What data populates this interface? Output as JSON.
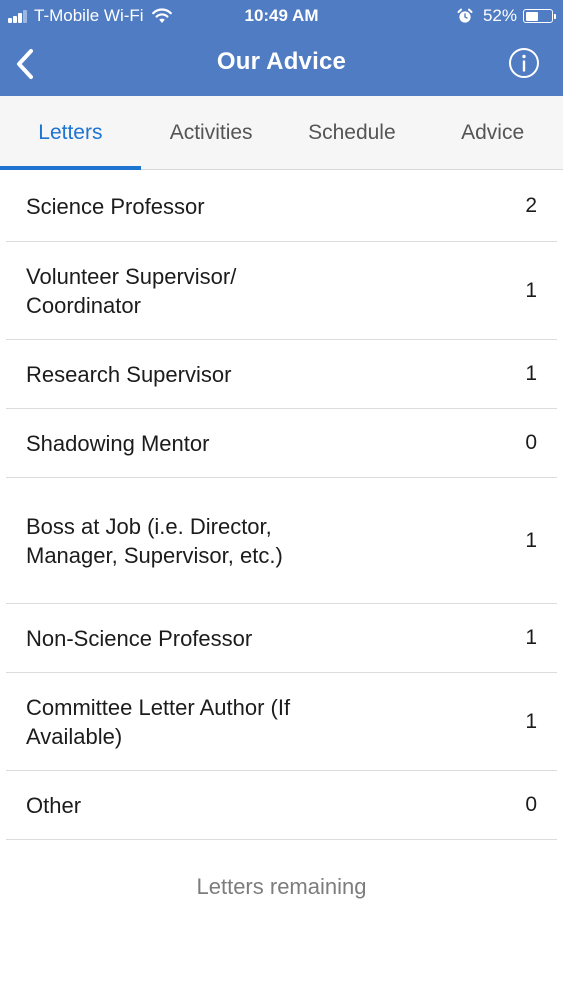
{
  "status_bar": {
    "carrier": "T-Mobile Wi-Fi",
    "time": "10:49 AM",
    "battery_percent": "52%",
    "battery_level": 0.52,
    "icons": [
      "signal-icon",
      "wifi-icon",
      "alarm-icon",
      "battery-icon"
    ]
  },
  "nav": {
    "title": "Our Advice",
    "back_icon": "chevron-left-icon",
    "info_icon": "info-icon",
    "color": "#4f7cc3"
  },
  "tabs": [
    {
      "label": "Letters",
      "active": true
    },
    {
      "label": "Activities",
      "active": false
    },
    {
      "label": "Schedule",
      "active": false
    },
    {
      "label": "Advice",
      "active": false
    }
  ],
  "accent_color": "#1f73d1",
  "letters": [
    {
      "label": "Science Professor",
      "count": "2"
    },
    {
      "label": "Volunteer Supervisor/\nCoordinator",
      "count": "1"
    },
    {
      "label": "Research Supervisor",
      "count": "1"
    },
    {
      "label": "Shadowing Mentor",
      "count": "0"
    },
    {
      "label": "Boss at Job (i.e. Director, Manager, Supervisor, etc.)",
      "count": "1"
    },
    {
      "label": "Non-Science Professor",
      "count": "1"
    },
    {
      "label": "Committee Letter Author (If Available)",
      "count": "1"
    },
    {
      "label": "Other",
      "count": "0"
    }
  ],
  "footer": {
    "label": "Letters remaining"
  }
}
